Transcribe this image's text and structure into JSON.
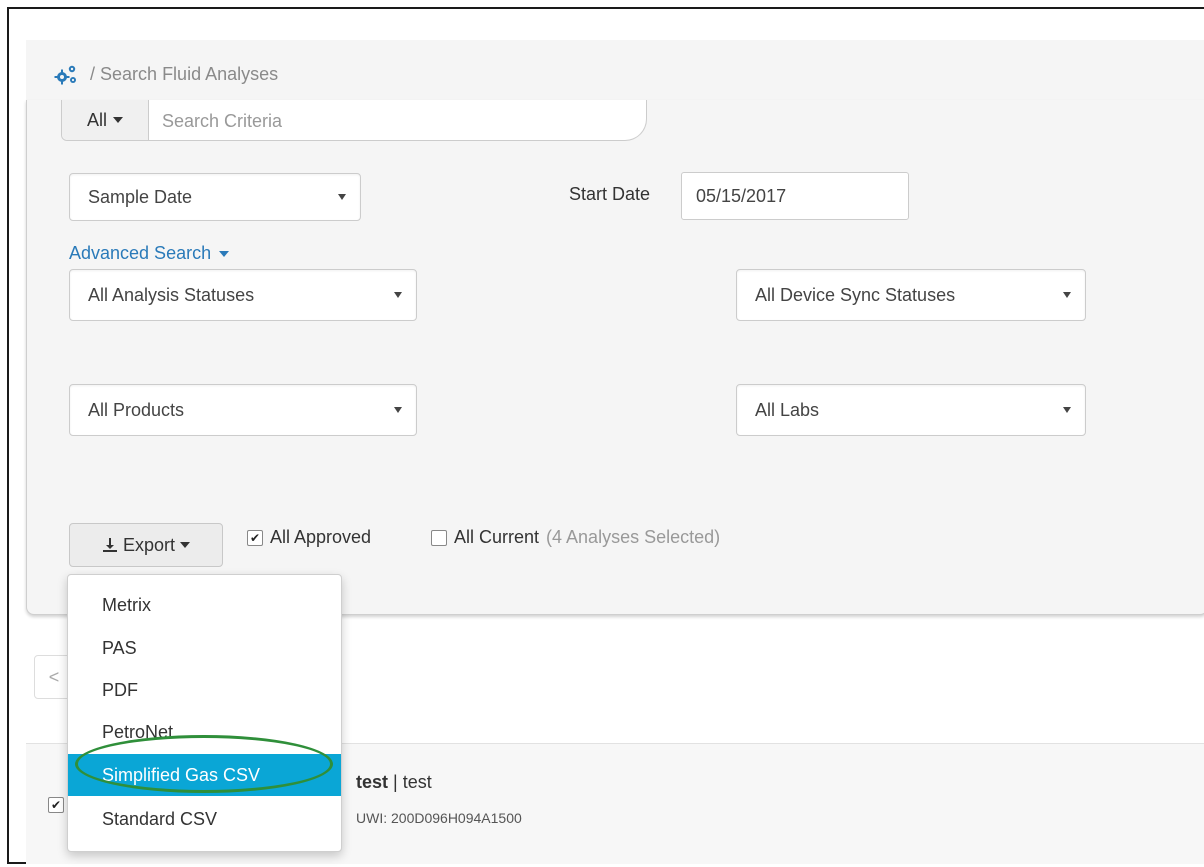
{
  "breadcrumb": {
    "separator": "/",
    "page": "Search Fluid Analyses",
    "icon": "gears-icon"
  },
  "search": {
    "scope_label": "All",
    "placeholder": "Search Criteria"
  },
  "date_filter": {
    "field_select": "Sample Date",
    "start_label": "Start Date",
    "start_value": "05/15/2017"
  },
  "advanced_search": {
    "label": "Advanced Search"
  },
  "filters": {
    "analysis_status": "All Analysis Statuses",
    "device_sync_status": "All Device Sync Statuses",
    "products": "All Products",
    "labs": "All Labs"
  },
  "export": {
    "button_label": "Export",
    "menu": [
      "Metrix",
      "PAS",
      "PDF",
      "PetroNet",
      "Simplified Gas CSV",
      "Standard CSV"
    ],
    "active_item": "Simplified Gas CSV"
  },
  "selection": {
    "all_approved_label": "All Approved",
    "all_approved_checked": true,
    "all_current_label": "All Current",
    "all_current_checked": false,
    "selected_note": "(4 Analyses Selected)"
  },
  "pager": {
    "prev": "<"
  },
  "result_row": {
    "name": "test",
    "separator": "|",
    "desc": "test",
    "uwi": "UWI: 200D096H094A1500",
    "checked": true
  },
  "colors": {
    "accent": "#2a7ab9",
    "menu_active": "#0aa6d6",
    "annotation_ring": "#2f8f3a"
  }
}
